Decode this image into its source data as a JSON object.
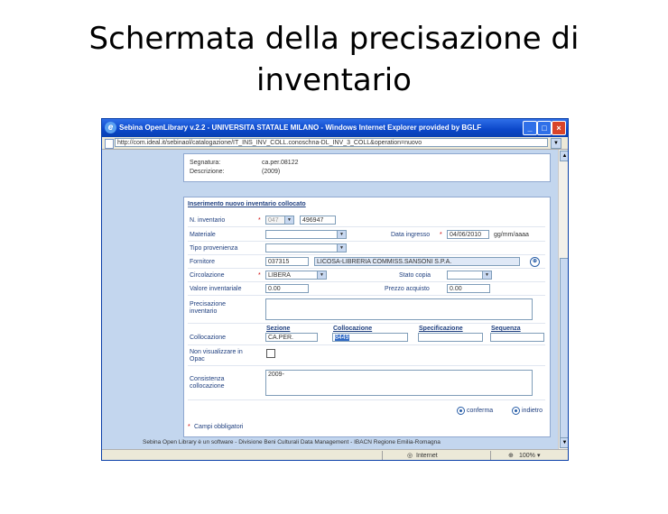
{
  "slide": {
    "title_line1": "Schermata della precisazione di",
    "title_line2": "inventario"
  },
  "window": {
    "title": "Sebina OpenLibrary v.2.2 - UNIVERSITA STATALE MILANO - Windows Internet Explorer provided by BGLF",
    "address": "http://com.ideal.it/sebinaol/catalogazione/IT_INS_INV_COLL.conoschna-DL_INV_3_COLL&operation=nuovo"
  },
  "record": {
    "segnatura_label": "Segnatura:",
    "segnatura_value": "ca.per.08122",
    "descrizione_label": "Descrizione:",
    "descrizione_value": "(2009)"
  },
  "form": {
    "section_title": "Inserimento nuovo inventario collocato",
    "n_inventario_label": "N. inventario",
    "n_inventario_prefix": "047",
    "n_inventario_value": "496947",
    "materiale_label": "Materiale",
    "data_ingresso_label": "Data ingresso",
    "data_ingresso_value": "04/06/2010",
    "data_format": "gg/mm/aaaa",
    "tipo_provenienza_label": "Tipo provenienza",
    "fornitore_label": "Fornitore",
    "fornitore_code": "037315",
    "fornitore_name": "LICOSA-LIBRERIA COMMISS.SANSONI S.P.A.",
    "circolazione_label": "Circolazione",
    "circolazione_value": "LIBERA",
    "stato_copia_label": "Stato copia",
    "valore_inventariale_label": "Valore inventariale",
    "valore_inventariale_value": "0.00",
    "prezzo_acquisto_label": "Prezzo acquisto",
    "prezzo_acquisto_value": "0.00",
    "precisazione_label_1": "Precisazione",
    "precisazione_label_2": "inventario",
    "collocazione_label": "Collocazione",
    "col_sezione": "Sezione",
    "col_collocazione": "Collocazione",
    "col_specificazione": "Specificazione",
    "col_sequenza": "Sequenza",
    "sezione_value": "CA.PER.",
    "collocazione_value": "8449",
    "non_visualizzare_label_1": "Non visualizzare in",
    "non_visualizzare_label_2": "Opac",
    "consistenza_label_1": "Consistenza",
    "consistenza_label_2": "collocazione",
    "consistenza_value": "2009-",
    "conferma_label": "conferma",
    "indietro_label": "indietro",
    "required_marker": "*",
    "required_note": "Campi obbligatori"
  },
  "footer": {
    "text": "Sebina Open Library è un software - Divisione Beni Culturali Data Management - IBACN Regione Emilia-Romagna"
  },
  "status": {
    "zone": "Internet",
    "zoom": "100%"
  }
}
